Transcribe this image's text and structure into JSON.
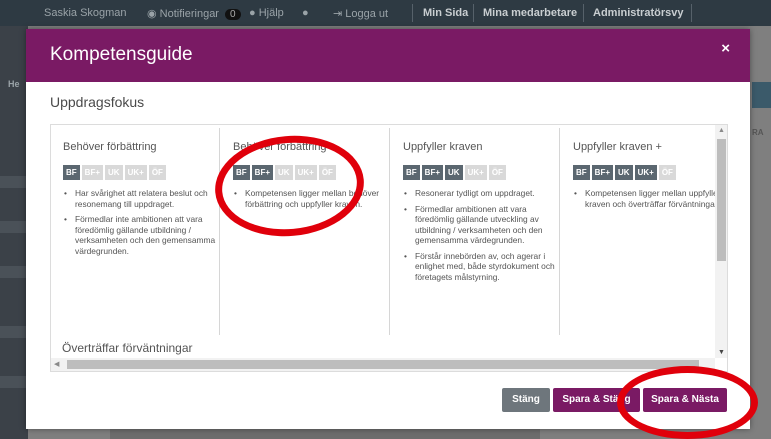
{
  "topbar": {
    "user": "Saskia Skogman",
    "notifications_label": "Notifieringar",
    "notifications_count": "0",
    "help": "Hjälp",
    "logout": "Logga ut",
    "my_page": "Min Sida",
    "my_colleagues": "Mina medarbetare",
    "admin_view": "Administratörsvy"
  },
  "background": {
    "rail_tab": "He",
    "right_text": "RA"
  },
  "modal": {
    "title": "Kompetensguide",
    "close_icon": "×",
    "section_title": "Uppdragsfokus",
    "columns": [
      {
        "title": "Behöver förbättring",
        "chips": [
          "BF",
          "BF+",
          "UK",
          "UK+",
          "ÖF"
        ],
        "active_chip": "BF",
        "bullets": [
          "Har svårighet att relatera beslut och resonemang till uppdraget.",
          "Förmedlar inte ambitionen att vara föredömlig gällande utbildning / verksamheten och den gemensamma värdegrunden."
        ]
      },
      {
        "title": "Behöver förbättring +",
        "chips": [
          "BF",
          "BF+",
          "UK",
          "UK+",
          "ÖF"
        ],
        "active_chip": "BF+",
        "bullets": [
          "Kompetensen ligger mellan behöver förbättring och uppfyller kraven."
        ]
      },
      {
        "title": "Uppfyller kraven",
        "chips": [
          "BF",
          "BF+",
          "UK",
          "UK+",
          "ÖF"
        ],
        "active_chip": "UK",
        "bullets": [
          "Resonerar tydligt om uppdraget.",
          "Förmedlar ambitionen att vara föredömlig gällande utveckling av utbildning / verksamheten och den gemensamma värdegrunden.",
          "Förstår innebörden av, och agerar i enlighet med, både styrdokument och företagets målstyrning."
        ]
      },
      {
        "title": "Uppfyller kraven +",
        "chips": [
          "BF",
          "BF+",
          "UK",
          "UK+",
          "ÖF"
        ],
        "active_chip": "UK+",
        "bullets": [
          "Kompetensen ligger mellan uppfyller kraven och överträffar förväntningar."
        ]
      }
    ],
    "next_column_title": "Överträffar förväntningar",
    "buttons": {
      "close": "Stäng",
      "save_close": "Spara & Stäng",
      "save_next": "Spara & Nästa"
    }
  },
  "colors": {
    "brand": "#7a1a64",
    "chip_active": "#5b6770",
    "chip_inactive": "#d9d9d9",
    "annotation": "#e0000b"
  }
}
